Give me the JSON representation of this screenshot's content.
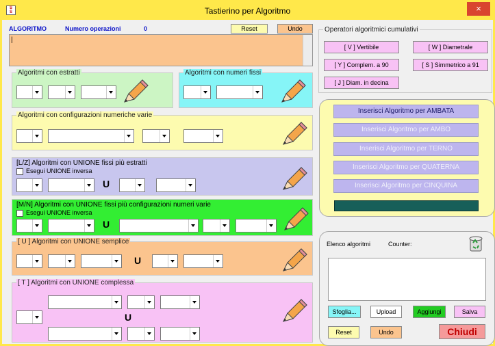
{
  "window": {
    "title": "Tastierino per Algoritmo",
    "icon_text": "Sis\nSim",
    "close_label": "×"
  },
  "header": {
    "algoritmo_label": "ALGORITMO",
    "numero_label": "Numero operazioni",
    "numero_value": "0",
    "reset_label": "Reset",
    "undo_label": "Undo",
    "text_value": "|"
  },
  "operators": {
    "title": "Operatori algoritmici cumulativi",
    "buttons": [
      "[ V ] Vertibile",
      "[ W ] Diametrale",
      "[ Y ] Complem. a 90",
      "[ S ] Simmetrico  a 91",
      "[ J ] Diam. in decina"
    ]
  },
  "sections": {
    "estratti": "Algoritmi con estratti",
    "fissi": "Algoritmi con numeri fissi",
    "config": "Algoritmi con configurazioni numeriche varie",
    "lz": "[L/Z] Algoritmi con UNIONE fissi più estratti",
    "mn": "[M/N] Algoritmi con UNIONE fissi più configurazioni numeri varie",
    "u": "[ U ] Algoritmi con UNIONE semplice",
    "t": "[ T ] Algoritmi con UNIONE complessa",
    "inversa": "Esegui UNIONE inversa",
    "u_letter": "U"
  },
  "insert": [
    "Inserisci Algoritmo per AMBATA",
    "Inserisci Algoritmo per AMBO",
    "Inserisci Algoritmo per TERNO",
    "Inserisci Algoritmo per QUATERNA",
    "Inserisci Algoritmo per CINQUINA"
  ],
  "elenco": {
    "label": "Elenco algoritmi",
    "counter_label": "Counter:",
    "sfoglia": "Sfoglia...",
    "upload": "Upload",
    "aggiungi": "Aggiungi",
    "salva": "Salva",
    "reset": "Reset",
    "undo": "Undo",
    "chiudi": "Chiudi"
  },
  "colors": {
    "title_bar": "#ffe84a",
    "green_panel": "#ccf5c4",
    "cyan_panel": "#86f5f7",
    "yellow_panel": "#fdfbaf",
    "lavender_panel": "#c8c6ee",
    "lime_panel": "#33ee33",
    "orange_panel": "#fbc48e",
    "pink_panel": "#f8c2f5"
  },
  "icons": [
    "pencil-icon",
    "recycle-bin-icon",
    "close-icon",
    "chevron-down-icon"
  ]
}
